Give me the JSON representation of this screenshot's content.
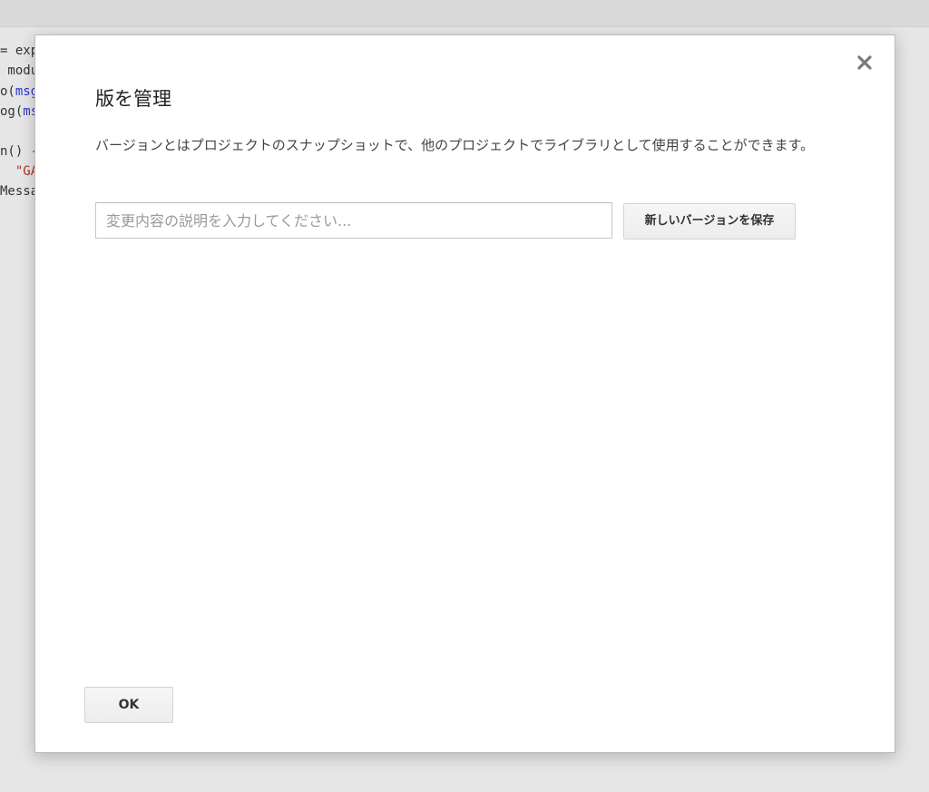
{
  "background_code": {
    "lines": [
      [
        {
          "t": "= exp",
          "c": ""
        }
      ],
      [
        {
          "t": " modu",
          "c": ""
        }
      ],
      [
        {
          "t": "o(",
          "c": ""
        },
        {
          "t": "msg",
          "c": "blue"
        }
      ],
      [
        {
          "t": "og(",
          "c": ""
        },
        {
          "t": "ms",
          "c": "blue"
        }
      ],
      [
        {
          "t": "",
          "c": ""
        }
      ],
      [
        {
          "t": "n() ",
          "c": ""
        },
        {
          "t": "-",
          "c": ""
        }
      ],
      [
        {
          "t": "  ",
          "c": ""
        },
        {
          "t": "\"GA",
          "c": "red"
        }
      ],
      [
        {
          "t": "Messa",
          "c": ""
        }
      ]
    ]
  },
  "dialog": {
    "title": "版を管理",
    "description": "バージョンとはプロジェクトのスナップショットで、他のプロジェクトでライブラリとして使用することができます。",
    "input": {
      "value": "",
      "placeholder": "変更内容の説明を入力してください..."
    },
    "save_button_label": "新しいバージョンを保存",
    "ok_button_label": "OK",
    "close_icon": "close-icon"
  },
  "colors": {
    "code_blue": "#2a35c6",
    "code_red": "#b0302a"
  }
}
